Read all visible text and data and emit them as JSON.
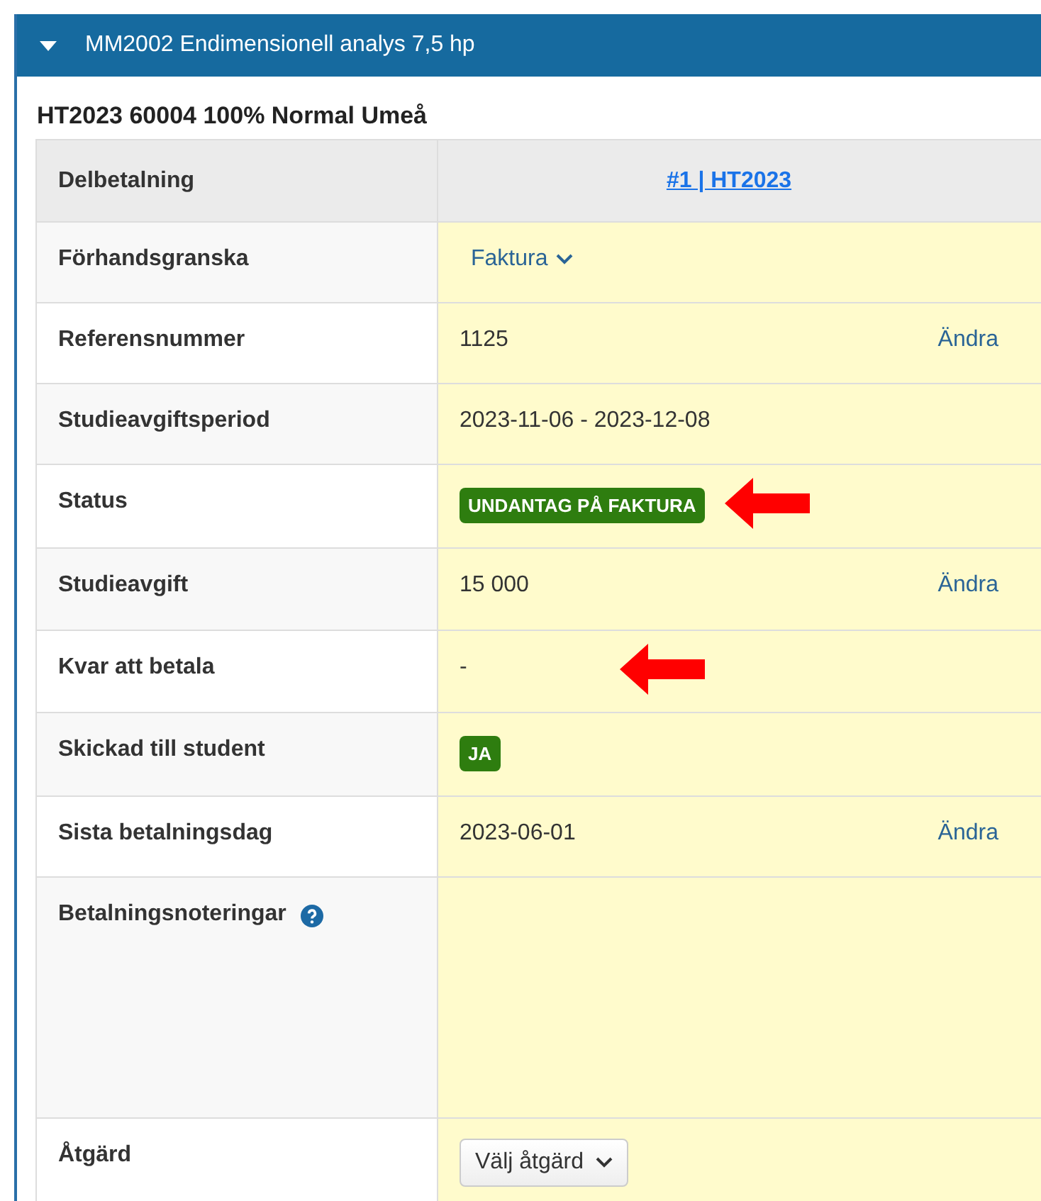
{
  "panel": {
    "title": "MM2002 Endimensionell analys 7,5 hp",
    "expanded": true
  },
  "subtitle": "HT2023 60004 100% Normal Umeå",
  "rows": [
    {
      "kind": "link",
      "label": "Delbetalning",
      "value": "#1 | HT2023"
    },
    {
      "kind": "dropdown",
      "label": "Förhandsgranska",
      "value": "Faktura"
    },
    {
      "kind": "text",
      "label": "Referensnummer",
      "value": "1125",
      "action": "Ändra"
    },
    {
      "kind": "text",
      "label": "Studieavgiftsperiod",
      "value": "2023-11-06 - 2023-12-08"
    },
    {
      "kind": "badge",
      "label": "Status",
      "value": "UNDANTAG PÅ FAKTURA",
      "arrow": true
    },
    {
      "kind": "text",
      "label": "Studieavgift",
      "value": "15 000",
      "action": "Ändra"
    },
    {
      "kind": "text",
      "label": "Kvar att betala",
      "value": "-",
      "arrow": true
    },
    {
      "kind": "badge",
      "label": "Skickad till student",
      "value": "JA"
    },
    {
      "kind": "text",
      "label": "Sista betalningsdag",
      "value": "2023-06-01",
      "action": "Ändra"
    },
    {
      "kind": "notes",
      "label": "Betalningsnoteringar",
      "help": true
    },
    {
      "kind": "select",
      "label": "Åtgärd",
      "value": "Välj åtgärd"
    }
  ]
}
